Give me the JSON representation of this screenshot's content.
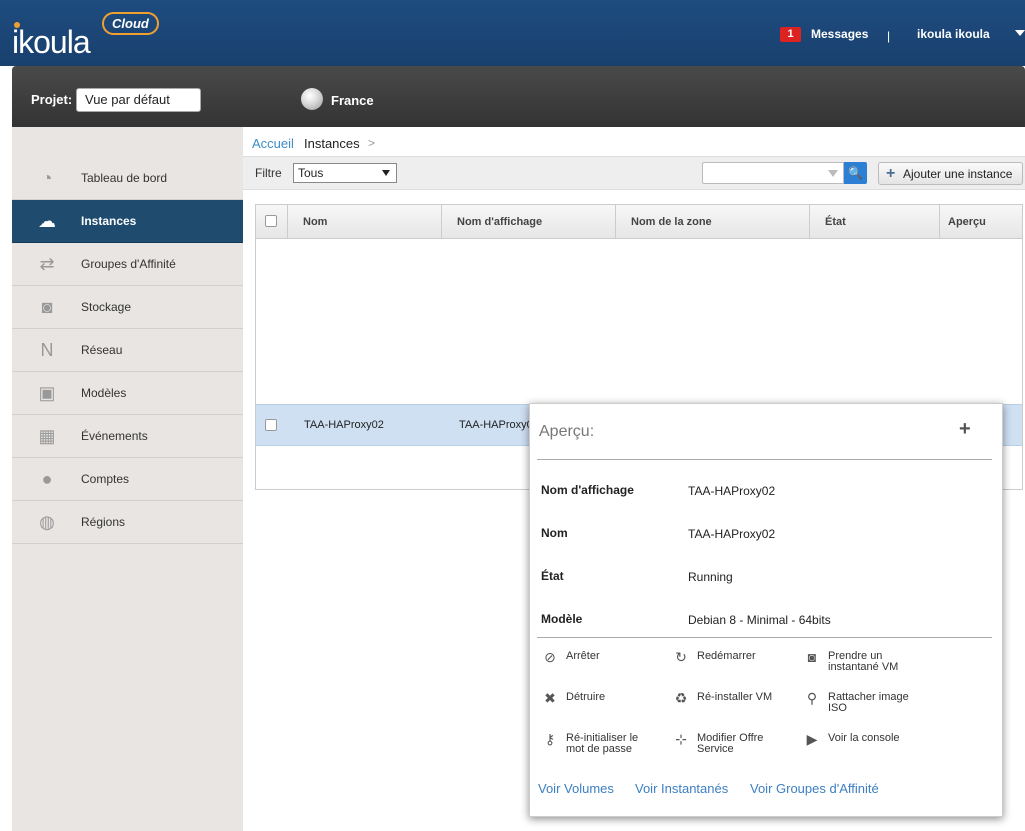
{
  "header": {
    "logo_text": "ikoula",
    "logo_cloud": "Cloud",
    "messages_count": "1",
    "messages_label": "Messages",
    "separator": "|",
    "user_label": "ikoula ikoula"
  },
  "project_bar": {
    "project_label": "Projet:",
    "project_value": "Vue par défaut",
    "region_label": "France"
  },
  "sidebar": {
    "items": [
      {
        "label": "Tableau de bord",
        "icon": "dashboard-icon"
      },
      {
        "label": "Instances",
        "icon": "cloud-icon"
      },
      {
        "label": "Groupes d'Affinité",
        "icon": "affinity-icon"
      },
      {
        "label": "Stockage",
        "icon": "storage-icon"
      },
      {
        "label": "Réseau",
        "icon": "network-icon"
      },
      {
        "label": "Modèles",
        "icon": "templates-icon"
      },
      {
        "label": "Événements",
        "icon": "calendar-icon"
      },
      {
        "label": "Comptes",
        "icon": "user-icon"
      },
      {
        "label": "Régions",
        "icon": "globe-icon"
      }
    ],
    "active_index": 1
  },
  "breadcrumb": {
    "home": "Accueil",
    "current": "Instances",
    "sep": ">"
  },
  "toolbar": {
    "filter_label": "Filtre",
    "filter_value": "Tous",
    "search_placeholder": "",
    "add_label": "Ajouter une instance"
  },
  "table": {
    "columns": [
      "Nom",
      "Nom d'affichage",
      "Nom de la zone",
      "État",
      "Aperçu"
    ],
    "rows": [
      {
        "nom": "TAA-HAProxy02",
        "display": "TAA-HAProxy02"
      }
    ]
  },
  "detail": {
    "title": "Aperçu:",
    "fields": [
      {
        "key": "Nom d'affichage",
        "value": "TAA-HAProxy02"
      },
      {
        "key": "Nom",
        "value": "TAA-HAProxy02"
      },
      {
        "key": "État",
        "value": "Running"
      },
      {
        "key": "Modèle",
        "value": "Debian 8 - Minimal - 64bits"
      }
    ],
    "actions": [
      {
        "line1": "Arrêter",
        "line2": ""
      },
      {
        "line1": "Redémarrer",
        "line2": ""
      },
      {
        "line1": "Prendre un",
        "line2": "instantané VM"
      },
      {
        "line1": "Détruire",
        "line2": ""
      },
      {
        "line1": "Ré-installer VM",
        "line2": ""
      },
      {
        "line1": "Rattacher image",
        "line2": "ISO"
      },
      {
        "line1": "Ré-initialiser le",
        "line2": "mot de passe"
      },
      {
        "line1": "Modifier Offre",
        "line2": "Service"
      },
      {
        "line1": "Voir la console",
        "line2": ""
      }
    ],
    "links": [
      "Voir Volumes",
      "Voir Instantanés",
      "Voir Groupes d'Affinité"
    ]
  },
  "colors": {
    "header_blue": "#1e4c80",
    "active_nav": "#1e4b6e",
    "link_blue": "#3c8ec8",
    "row_highlight": "#cfe0f3",
    "badge_red": "#dd2222"
  }
}
